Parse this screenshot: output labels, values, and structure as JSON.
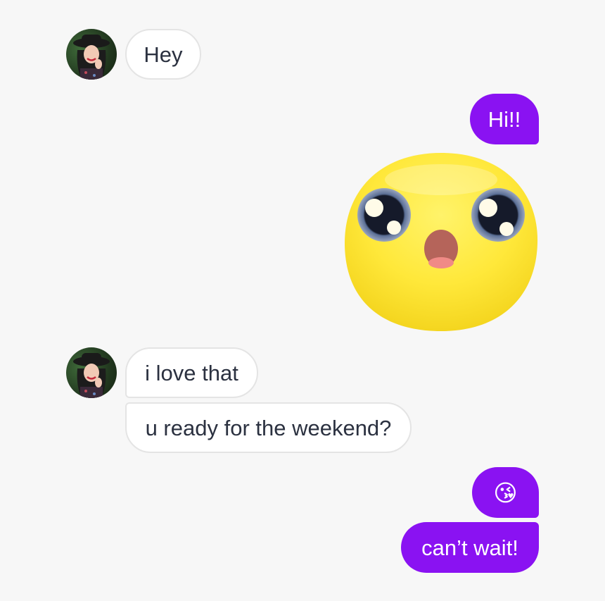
{
  "colors": {
    "background": "#f7f7f7",
    "incoming_bubble": "#ffffff",
    "incoming_text": "#2b3140",
    "outgoing_bubble": "#8a12f2",
    "outgoing_text": "#ffffff"
  },
  "messages": [
    {
      "sender": "them",
      "text": "Hey"
    },
    {
      "sender": "me",
      "text": "Hi!!"
    },
    {
      "sender": "me",
      "sticker": "surprised-face-sticker"
    },
    {
      "sender": "them",
      "text": "i love that"
    },
    {
      "sender": "them",
      "text": "u ready for the weekend?"
    },
    {
      "sender": "me",
      "text": "😘"
    },
    {
      "sender": "me",
      "text": "can’t wait!"
    }
  ]
}
